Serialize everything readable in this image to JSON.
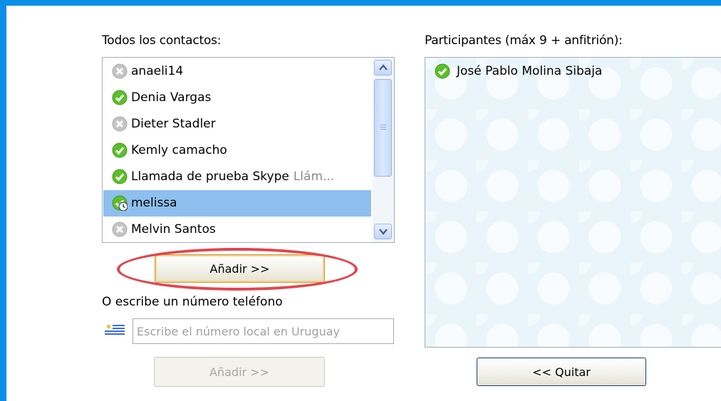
{
  "dialog": {
    "contacts_heading": "Todos los contactos:",
    "participants_heading": "Participantes (máx 9 + anfitrión):",
    "phone_heading": "O escribe un número teléfono"
  },
  "contacts": [
    {
      "name": "anaeli14",
      "mood": "",
      "status": "offline",
      "selected": false
    },
    {
      "name": "Denia Vargas",
      "mood": "",
      "status": "online",
      "selected": false
    },
    {
      "name": "Dieter Stadler",
      "mood": "",
      "status": "offline",
      "selected": false
    },
    {
      "name": "Kemly camacho",
      "mood": "",
      "status": "online",
      "selected": false
    },
    {
      "name": "Llamada de prueba Skype",
      "mood": "Llám...",
      "status": "online",
      "selected": false
    },
    {
      "name": "melissa",
      "mood": "",
      "status": "away",
      "selected": true
    },
    {
      "name": "Melvin Santos",
      "mood": "",
      "status": "offline",
      "selected": false
    }
  ],
  "participants": [
    {
      "name": "José Pablo Molina Sibaja",
      "status": "online"
    }
  ],
  "buttons": {
    "add_contact": "Añadir >>",
    "add_number": "Añadir >>",
    "remove": "<< Quitar"
  },
  "phone_input": {
    "placeholder": "Escribe el número local en Uruguay",
    "value": ""
  },
  "icons": {
    "online": "status-online-icon",
    "offline": "status-offline-icon",
    "away": "status-away-icon",
    "flag": "uruguay-flag-icon"
  },
  "colors": {
    "frame": "#0a8ee8",
    "selection": "#8fbfee",
    "online": "#5cbf2a",
    "offline": "#c4c4c4",
    "highlight": "#e2454d"
  }
}
